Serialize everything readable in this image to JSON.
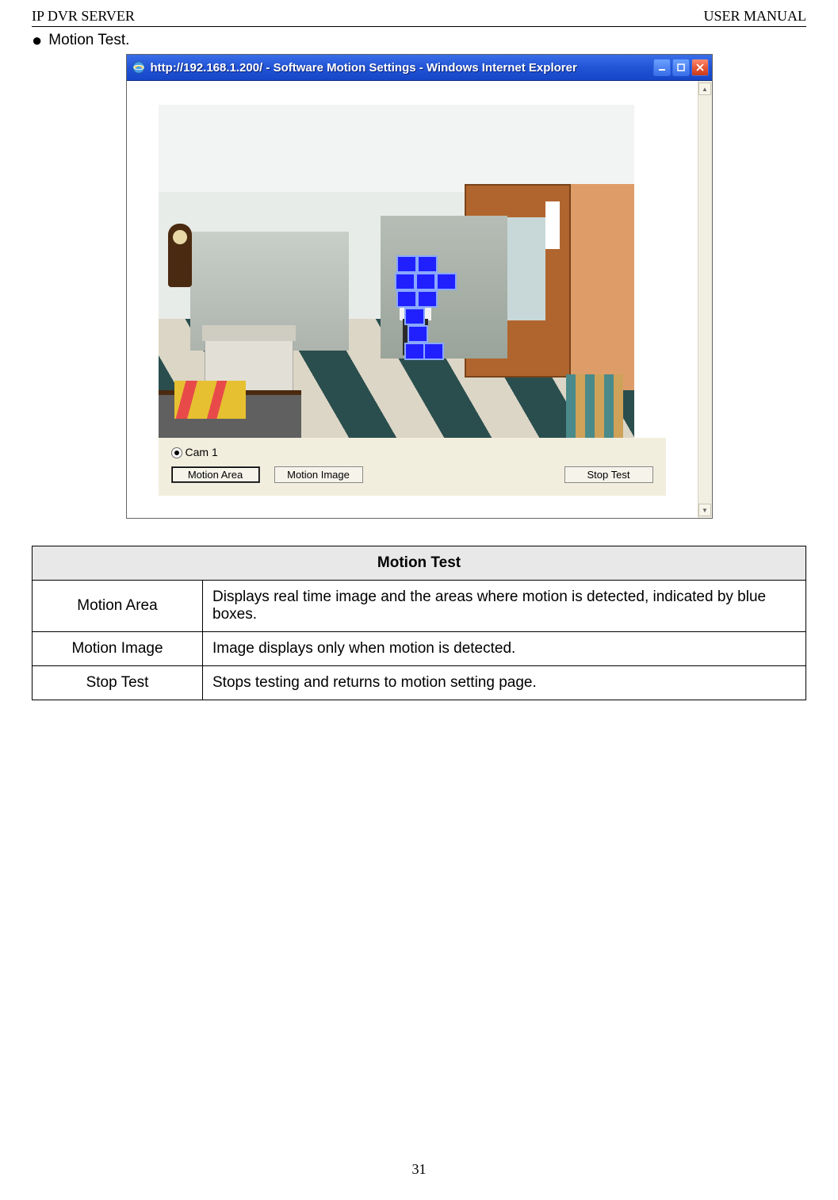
{
  "header": {
    "left": "IP DVR SERVER",
    "right": "USER MANUAL"
  },
  "bullet": "Motion Test.",
  "window": {
    "title": "http://192.168.1.200/ - Software Motion Settings - Windows Internet Explorer",
    "icon_name": "ie-logo-icon",
    "buttons": {
      "minimize": "–",
      "maximize": "□",
      "close": "×"
    },
    "radio_label": "Cam 1",
    "btn_motion_area": "Motion Area",
    "btn_motion_image": "Motion Image",
    "btn_stop_test": "Stop Test",
    "motion_boxes": [
      {
        "l": 300,
        "t": 190,
        "kind": "motion-grid-cell"
      },
      {
        "l": 326,
        "t": 190,
        "kind": "motion-grid-cell"
      },
      {
        "l": 298,
        "t": 212,
        "kind": "motion-grid-cell"
      },
      {
        "l": 324,
        "t": 212,
        "kind": "motion-grid-cell"
      },
      {
        "l": 350,
        "t": 212,
        "kind": "motion-grid-cell"
      },
      {
        "l": 300,
        "t": 234,
        "kind": "motion-grid-cell"
      },
      {
        "l": 326,
        "t": 234,
        "kind": "motion-grid-cell"
      },
      {
        "l": 310,
        "t": 256,
        "kind": "motion-grid-cell"
      },
      {
        "l": 314,
        "t": 278,
        "kind": "motion-grid-cell"
      },
      {
        "l": 310,
        "t": 300,
        "kind": "motion-grid-cell"
      },
      {
        "l": 334,
        "t": 300,
        "kind": "motion-grid-cell"
      }
    ],
    "scene_elements": {
      "clock": "grandfather-clock",
      "copier": "office-copier",
      "door": "wooden-door",
      "person": "person-walking",
      "shelf": "bookshelf",
      "partitions": "cubicle-partitions",
      "folders": "file-folders",
      "floor": "checker-tile-floor"
    }
  },
  "table": {
    "title": "Motion Test",
    "rows": [
      {
        "term": "Motion Area",
        "desc": "Displays real time image and the areas where motion is detected, indicated by blue boxes."
      },
      {
        "term": "Motion Image",
        "desc": "Image displays only when motion is detected."
      },
      {
        "term": "Stop Test",
        "desc": "Stops testing and returns to motion setting page."
      }
    ]
  },
  "page_number": "31"
}
